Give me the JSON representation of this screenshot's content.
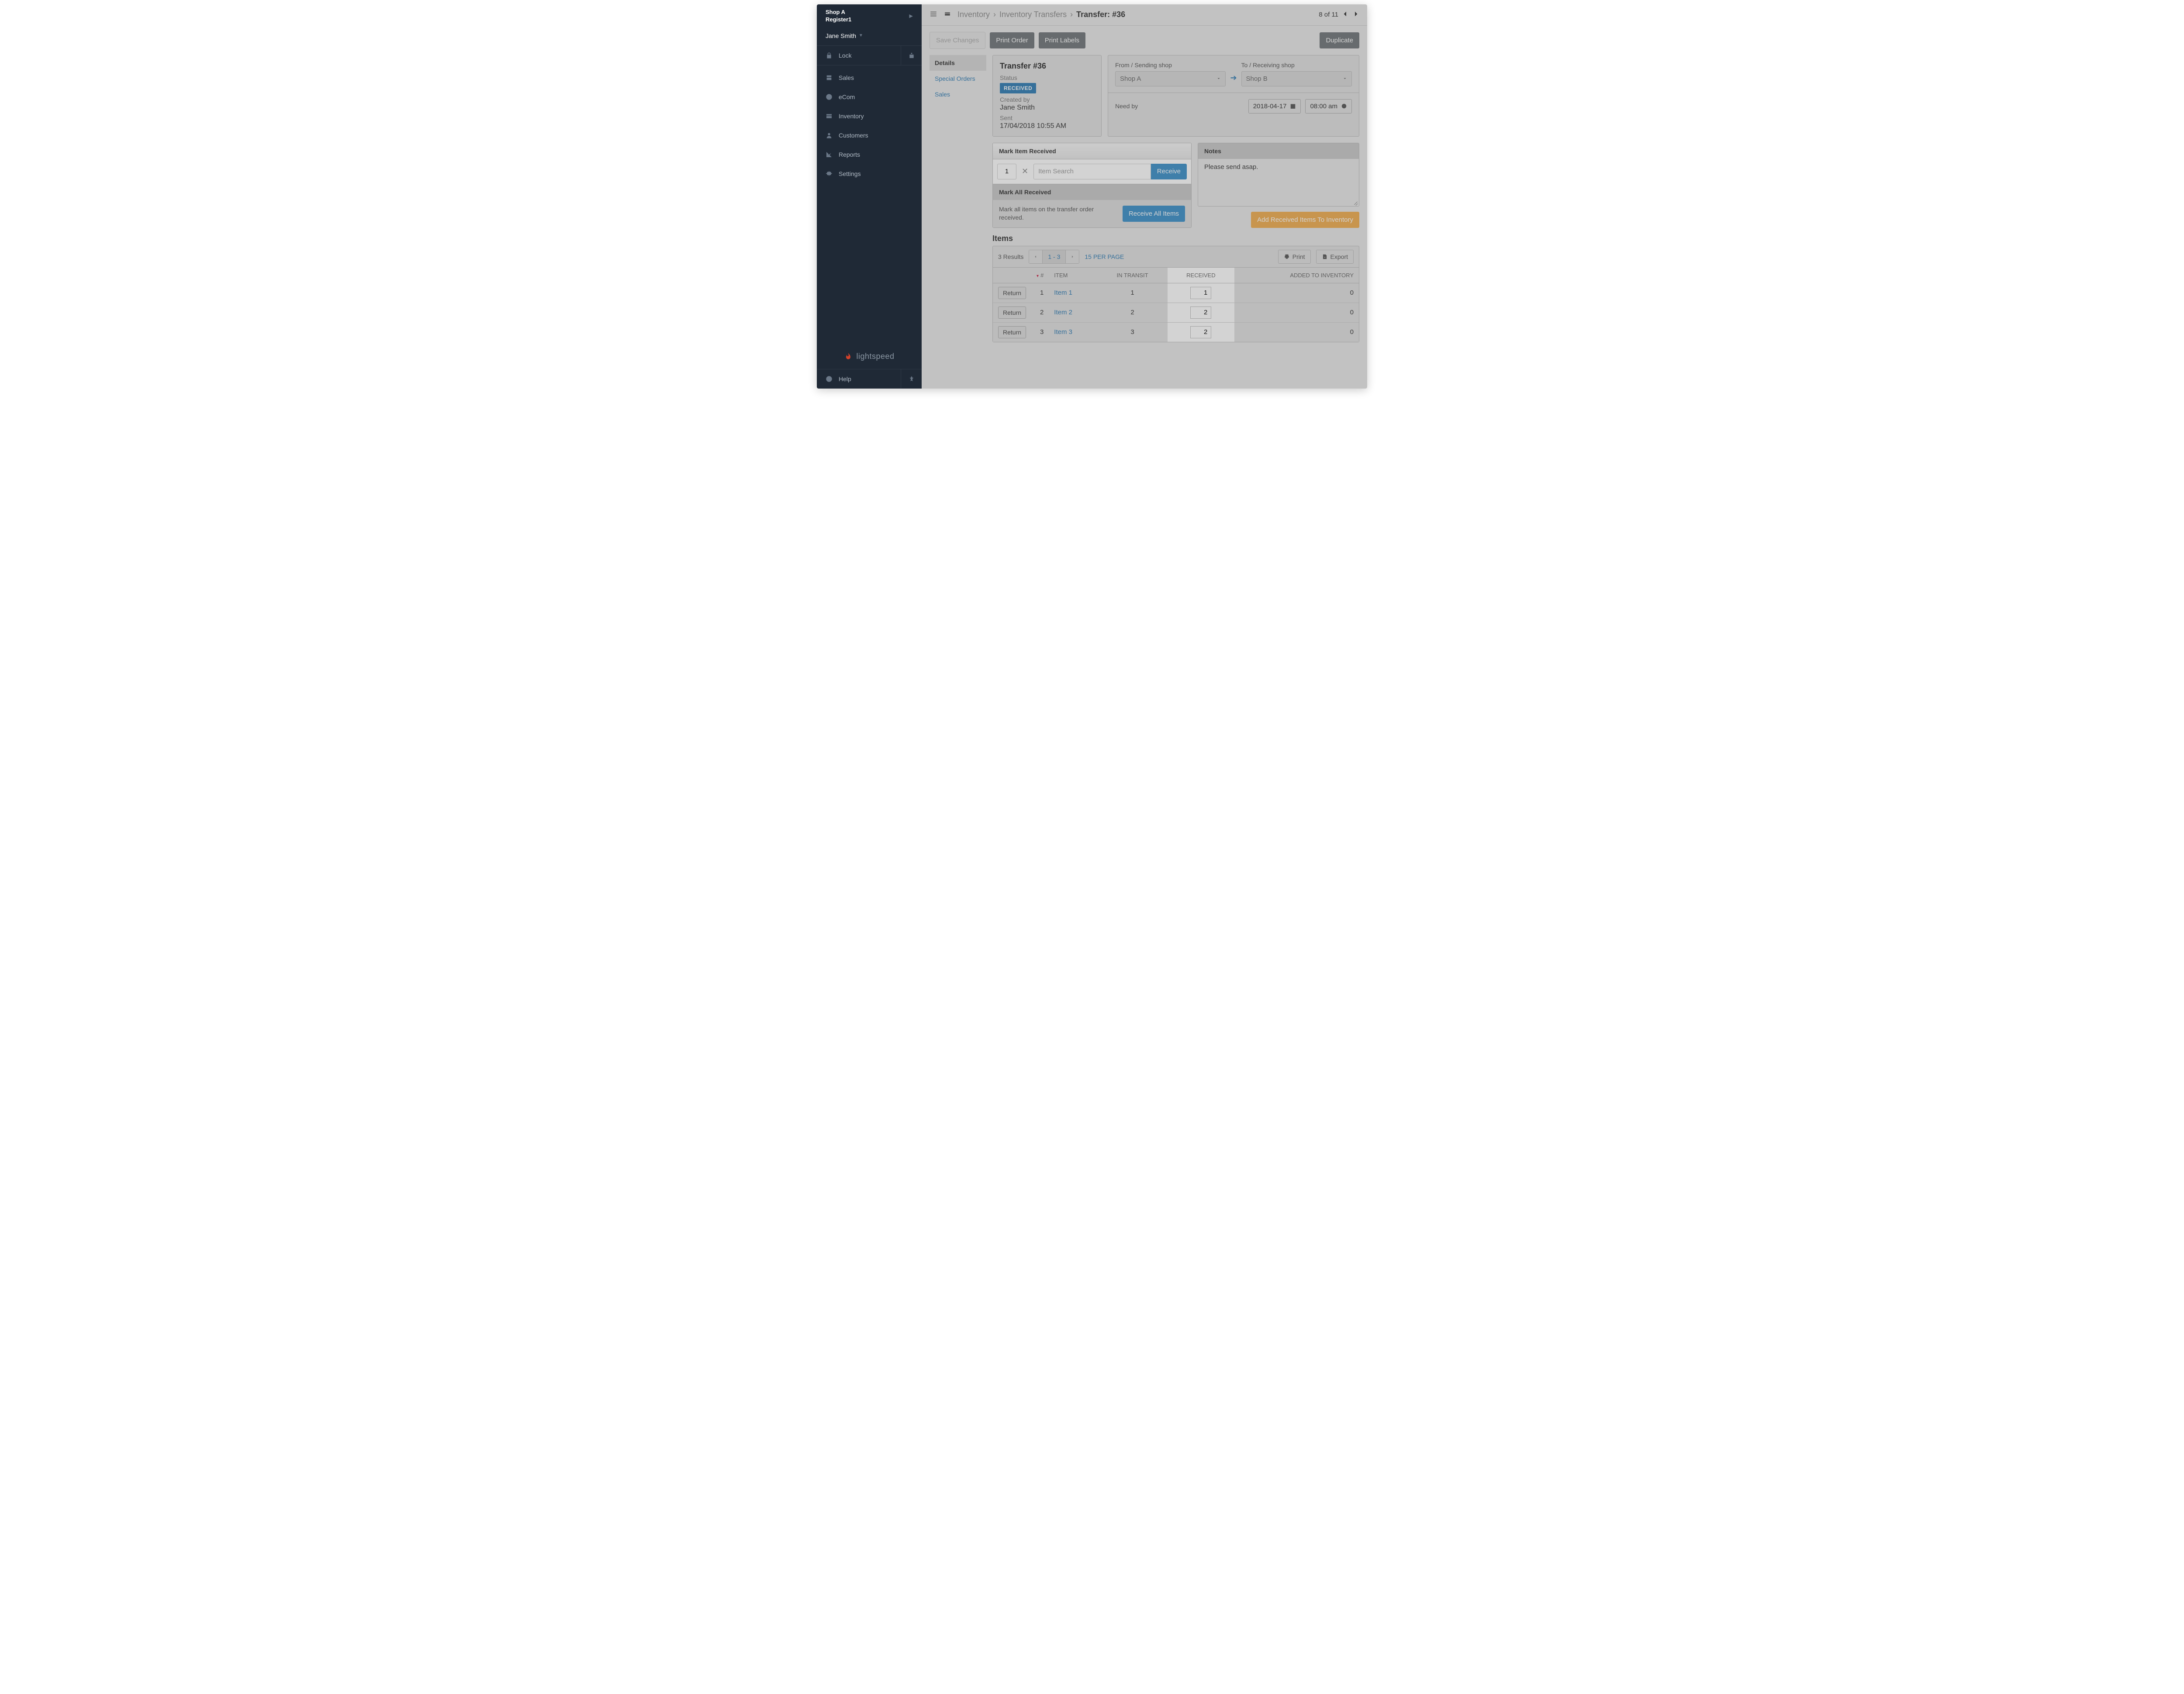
{
  "sidebar": {
    "shop": "Shop A",
    "register": "Register1",
    "user": "Jane Smith",
    "lock": "Lock",
    "nav": [
      "Sales",
      "eCom",
      "Inventory",
      "Customers",
      "Reports",
      "Settings"
    ],
    "brand": "lightspeed",
    "help": "Help"
  },
  "breadcrumb": {
    "a": "Inventory",
    "b": "Inventory Transfers",
    "c": "Transfer: #36"
  },
  "pager": {
    "text": "8 of 11"
  },
  "actions": {
    "save": "Save Changes",
    "print_order": "Print Order",
    "print_labels": "Print Labels",
    "duplicate": "Duplicate"
  },
  "subnav": {
    "details": "Details",
    "special": "Special Orders",
    "sales": "Sales"
  },
  "transfer": {
    "title": "Transfer #36",
    "status_label": "Status",
    "status_badge": "RECEIVED",
    "created_label": "Created by",
    "created_by": "Jane Smith",
    "sent_label": "Sent",
    "sent_value": "17/04/2018 10:55 AM"
  },
  "shipping": {
    "from_label": "From / Sending shop",
    "from_value": "Shop A",
    "to_label": "To / Receiving shop",
    "to_value": "Shop B",
    "needby_label": "Need by",
    "needby_date": "2018-04-17",
    "needby_time": "08:00 am"
  },
  "mark_received": {
    "heading": "Mark Item Received",
    "qty": "1",
    "placeholder": "Item Search",
    "receive": "Receive",
    "all_heading": "Mark All Received",
    "all_text": "Mark all items on the transfer order received.",
    "receive_all": "Receive All Items"
  },
  "notes": {
    "heading": "Notes",
    "text": "Please send asap."
  },
  "add_inventory": "Add Received Items To Inventory",
  "items": {
    "heading": "Items",
    "results": "3 Results",
    "range": "1 - 3",
    "per_page": "15 PER PAGE",
    "print": "Print",
    "export": "Export",
    "cols": {
      "num": "#",
      "item": "ITEM",
      "in_transit": "IN TRANSIT",
      "received": "RECEIVED",
      "added": "ADDED TO INVENTORY",
      "return": "Return"
    },
    "rows": [
      {
        "num": "1",
        "item": "Item 1",
        "in_transit": "1",
        "received": "1",
        "added": "0"
      },
      {
        "num": "2",
        "item": "Item 2",
        "in_transit": "2",
        "received": "2",
        "added": "0"
      },
      {
        "num": "3",
        "item": "Item 3",
        "in_transit": "3",
        "received": "2",
        "added": "0"
      }
    ]
  }
}
